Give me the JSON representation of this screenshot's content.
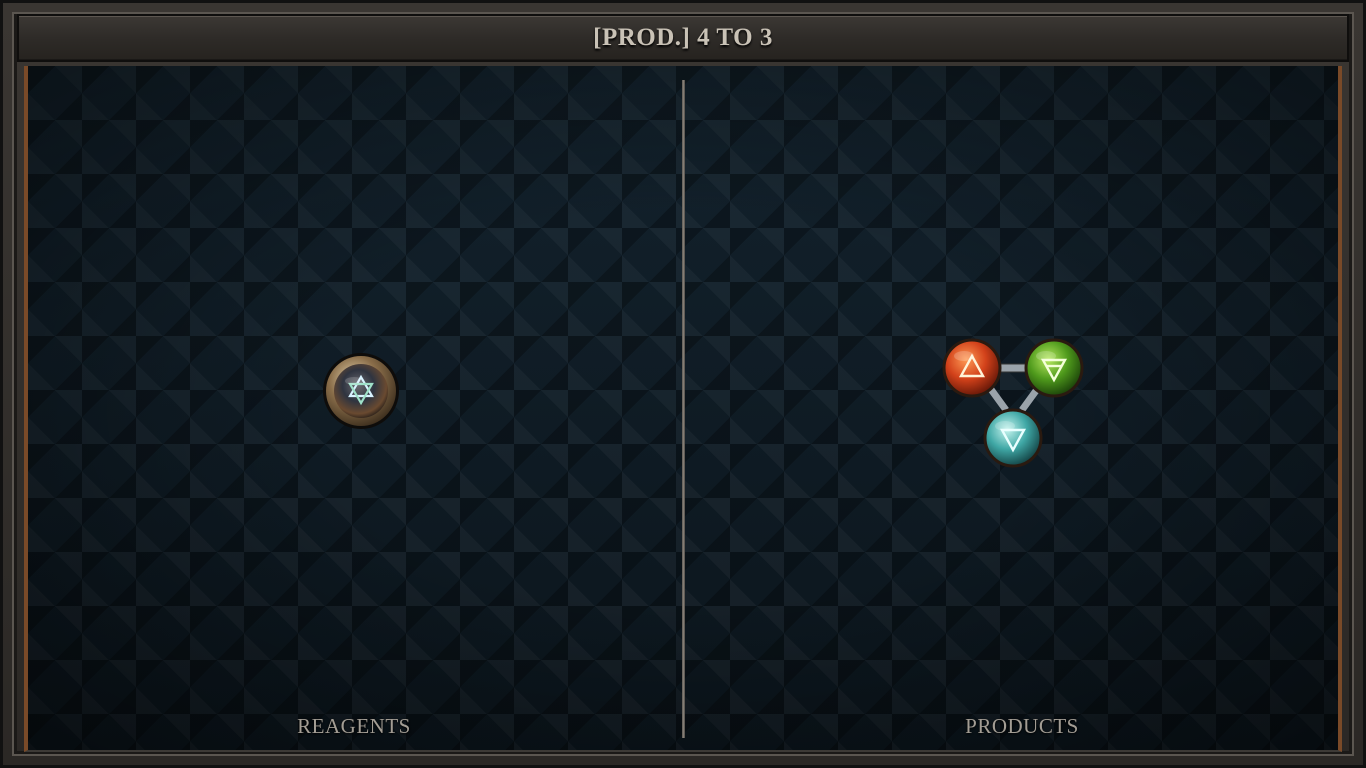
{
  "title": "[PROD.] 4 TO 3",
  "panels": {
    "reagents_label": "REAGENTS",
    "products_label": "PRODUCTS"
  },
  "reagent": {
    "icon": "quintessence-icon",
    "symbol": "hexagram"
  },
  "products": [
    {
      "icon": "fire-element-icon",
      "element": "fire",
      "color": "#d2411a"
    },
    {
      "icon": "air-element-icon",
      "element": "air",
      "color": "#4f9a1c"
    },
    {
      "icon": "water-element-icon",
      "element": "water",
      "color": "#3fa7a5"
    }
  ],
  "colors": {
    "board": "#0d1820",
    "frame": "#2b2825",
    "accent_rail": "#7a4a28",
    "label_text": "#a39d94"
  }
}
